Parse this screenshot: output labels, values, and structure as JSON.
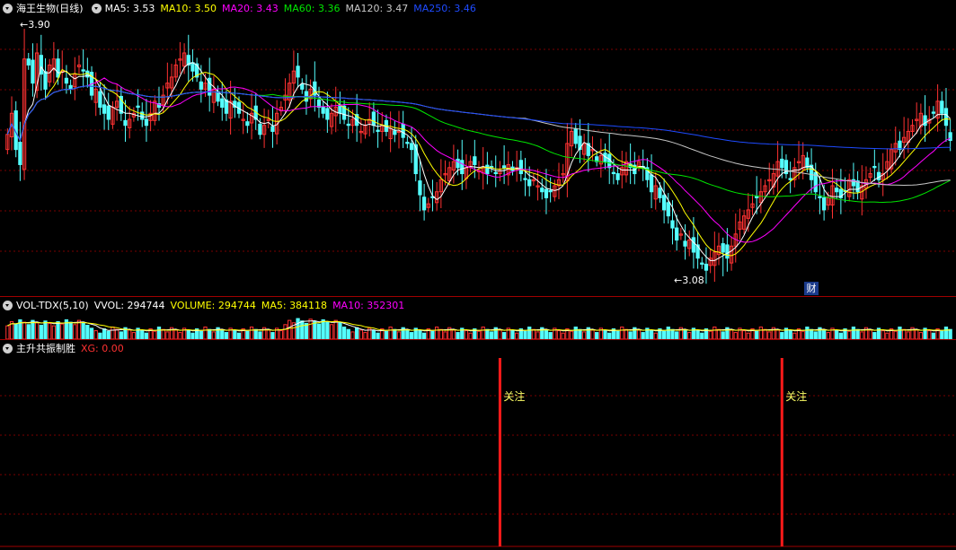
{
  "colors": {
    "up": "#ff3232",
    "down": "#54ffff",
    "ma5": "#ffffff",
    "ma10": "#ffff00",
    "ma20": "#ff00ff",
    "ma60": "#00e600",
    "ma120": "#c8c8c8",
    "ma250": "#1e4bff",
    "grid": "#7a0000",
    "divider": "#a00000",
    "signal": "#ff1a1a"
  },
  "main": {
    "stock_name": "海王生物(日线)",
    "ma5_label": "MA5:",
    "ma5_value": "3.53",
    "ma10_label": "MA10:",
    "ma10_value": "3.50",
    "ma20_label": "MA20:",
    "ma20_value": "3.43",
    "ma60_label": "MA60:",
    "ma60_value": "3.36",
    "ma120_label": "MA120:",
    "ma120_value": "3.47",
    "ma250_label": "MA250:",
    "ma250_value": "3.46",
    "high_marker": "3.90",
    "low_marker": "3.08",
    "finance_badge": "财"
  },
  "volume": {
    "indicator": "VOL-TDX(5,10)",
    "vvol_label": "VVOL:",
    "vvol_value": "294744",
    "volume_label": "VOLUME:",
    "volume_value": "294744",
    "ma5_label": "MA5:",
    "ma5_value": "384118",
    "ma10_label": "MA10:",
    "ma10_value": "352301"
  },
  "indicator": {
    "name": "主升共振制胜",
    "xg_label": "XG:",
    "xg_value": "0.00",
    "signals": [
      {
        "label": "关注",
        "bar_index": 117
      },
      {
        "label": "关注",
        "bar_index": 184
      }
    ]
  },
  "chart_data": {
    "type": "candlestick",
    "price_range": [
      3.05,
      3.93
    ],
    "high_point": {
      "value": 3.9,
      "bar_index": 4
    },
    "low_point": {
      "value": 3.08,
      "bar_index": 170
    },
    "closes": [
      3.55,
      3.62,
      3.5,
      3.45,
      3.8,
      3.78,
      3.72,
      3.82,
      3.75,
      3.7,
      3.78,
      3.8,
      3.74,
      3.76,
      3.72,
      3.7,
      3.75,
      3.78,
      3.76,
      3.74,
      3.68,
      3.7,
      3.64,
      3.62,
      3.6,
      3.64,
      3.66,
      3.62,
      3.58,
      3.6,
      3.62,
      3.64,
      3.6,
      3.58,
      3.62,
      3.66,
      3.64,
      3.68,
      3.72,
      3.74,
      3.78,
      3.8,
      3.82,
      3.78,
      3.76,
      3.74,
      3.7,
      3.72,
      3.68,
      3.7,
      3.66,
      3.64,
      3.62,
      3.66,
      3.64,
      3.62,
      3.6,
      3.58,
      3.62,
      3.6,
      3.55,
      3.58,
      3.6,
      3.56,
      3.62,
      3.64,
      3.68,
      3.72,
      3.76,
      3.74,
      3.7,
      3.66,
      3.7,
      3.68,
      3.64,
      3.62,
      3.6,
      3.62,
      3.64,
      3.62,
      3.6,
      3.58,
      3.6,
      3.58,
      3.56,
      3.58,
      3.6,
      3.58,
      3.56,
      3.58,
      3.56,
      3.57,
      3.55,
      3.56,
      3.54,
      3.52,
      3.5,
      3.42,
      3.35,
      3.3,
      3.32,
      3.34,
      3.36,
      3.4,
      3.42,
      3.44,
      3.46,
      3.44,
      3.42,
      3.44,
      3.46,
      3.45,
      3.43,
      3.44,
      3.42,
      3.44,
      3.42,
      3.43,
      3.44,
      3.45,
      3.43,
      3.44,
      3.42,
      3.4,
      3.38,
      3.4,
      3.38,
      3.36,
      3.34,
      3.36,
      3.38,
      3.4,
      3.42,
      3.52,
      3.56,
      3.52,
      3.5,
      3.52,
      3.48,
      3.5,
      3.46,
      3.48,
      3.46,
      3.44,
      3.42,
      3.4,
      3.44,
      3.46,
      3.44,
      3.42,
      3.46,
      3.44,
      3.4,
      3.36,
      3.38,
      3.34,
      3.3,
      3.28,
      3.24,
      3.2,
      3.22,
      3.18,
      3.2,
      3.16,
      3.14,
      3.12,
      3.1,
      3.14,
      3.16,
      3.18,
      3.16,
      3.14,
      3.18,
      3.22,
      3.26,
      3.28,
      3.3,
      3.32,
      3.34,
      3.36,
      3.38,
      3.4,
      3.42,
      3.46,
      3.44,
      3.42,
      3.4,
      3.44,
      3.46,
      3.48,
      3.44,
      3.4,
      3.36,
      3.34,
      3.3,
      3.34,
      3.38,
      3.36,
      3.34,
      3.36,
      3.4,
      3.38,
      3.36,
      3.38,
      3.4,
      3.42,
      3.44,
      3.4,
      3.42,
      3.46,
      3.5,
      3.52,
      3.5,
      3.54,
      3.56,
      3.58,
      3.6,
      3.62,
      3.58,
      3.6,
      3.62,
      3.66,
      3.62,
      3.58,
      3.53
    ]
  }
}
